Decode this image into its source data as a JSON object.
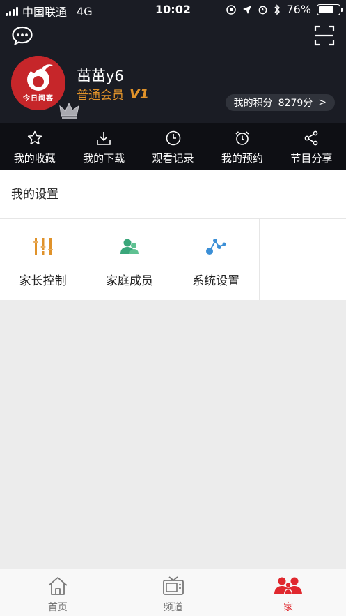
{
  "status_bar": {
    "carrier": "中国联通",
    "network": "4G",
    "time": "10:02",
    "battery": "76%",
    "battery_level": 0.76
  },
  "profile": {
    "avatar_text": "今日闽客",
    "username": "茁茁y6",
    "member_label": "普通会员",
    "member_level": "V1",
    "points_label": "我的积分",
    "points_value": "8279分",
    "points_arrow": ">"
  },
  "shortcuts": [
    {
      "label": "我的收藏",
      "icon": "star-icon"
    },
    {
      "label": "我的下载",
      "icon": "download-icon"
    },
    {
      "label": "观看记录",
      "icon": "clock-icon"
    },
    {
      "label": "我的预约",
      "icon": "alarm-icon"
    },
    {
      "label": "节目分享",
      "icon": "share-icon"
    }
  ],
  "settings": {
    "title": "我的设置",
    "tiles": [
      {
        "label": "家长控制",
        "icon": "sliders-icon",
        "color": "#e0922a"
      },
      {
        "label": "家庭成员",
        "icon": "users-icon",
        "color": "#3aa67a"
      },
      {
        "label": "系统设置",
        "icon": "nodes-icon",
        "color": "#3b8fd6"
      }
    ]
  },
  "tabbar": {
    "tabs": [
      {
        "label": "首页",
        "icon": "home-icon"
      },
      {
        "label": "频道",
        "icon": "tv-icon"
      },
      {
        "label": "家",
        "icon": "family-icon",
        "active": true
      }
    ]
  },
  "colors": {
    "header_bg": "#1a1c24",
    "accent_red": "#e0282e",
    "member_gold": "#e0922a"
  }
}
